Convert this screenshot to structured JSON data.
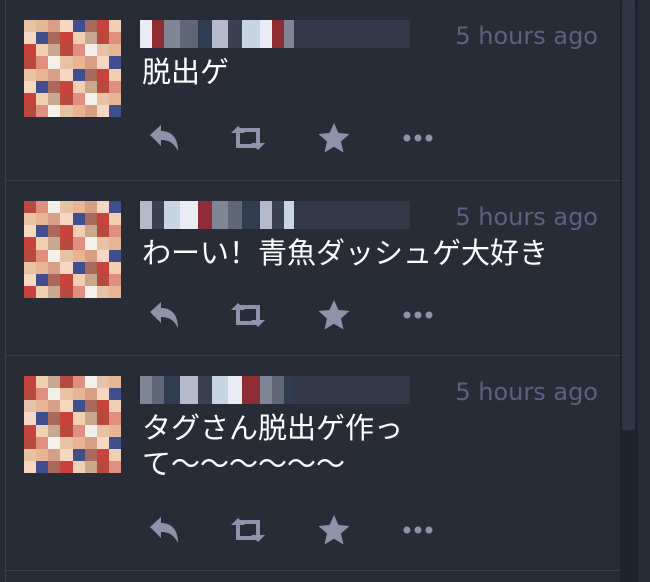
{
  "statuses": [
    {
      "timestamp": "5 hours ago",
      "content": "脱出ゲ"
    },
    {
      "timestamp": "5 hours ago",
      "content": "わーい！青魚ダッシュゲ大好き"
    },
    {
      "timestamp": "5 hours ago",
      "content": "タグさん脱出ゲ作って〜〜〜〜〜〜"
    }
  ],
  "icons": {
    "reply": "reply-icon",
    "boost": "retweet-icon",
    "favourite": "star-icon",
    "more": "ellipsis-icon"
  },
  "colors": {
    "background": "#282c37",
    "text": "#ffffff",
    "muted": "#5a6283",
    "icon": "#8d93ab"
  }
}
